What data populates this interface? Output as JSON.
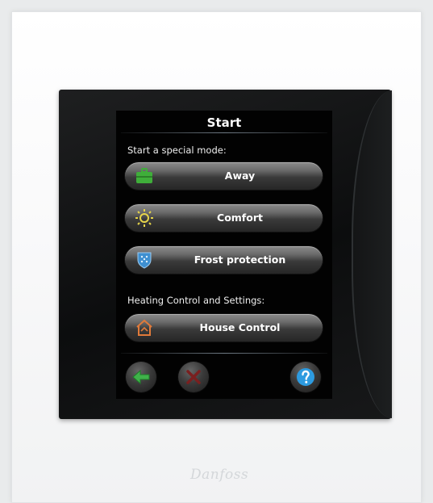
{
  "screen": {
    "title": "Start",
    "special_mode_label": "Start a special mode:",
    "heating_label": "Heating Control and Settings:"
  },
  "buttons": {
    "away": {
      "label": "Away",
      "icon": "suitcase-icon",
      "icon_color": "#3fae3a"
    },
    "comfort": {
      "label": "Comfort",
      "icon": "sun-icon",
      "icon_color": "#e6d44a"
    },
    "frost": {
      "label": "Frost protection",
      "icon": "snowflake-shield-icon",
      "icon_color": "#3e8fd0"
    },
    "house": {
      "label": "House Control",
      "icon": "house-icon",
      "icon_color": "#e07a3a"
    }
  },
  "nav": {
    "back": {
      "icon": "back-arrow-icon",
      "color": "#3fb24a"
    },
    "cancel": {
      "icon": "close-icon",
      "color": "#7a1f1f"
    },
    "help": {
      "icon": "help-icon",
      "color": "#2d9be0"
    }
  },
  "brand": {
    "logo_text": "Danfoss"
  }
}
